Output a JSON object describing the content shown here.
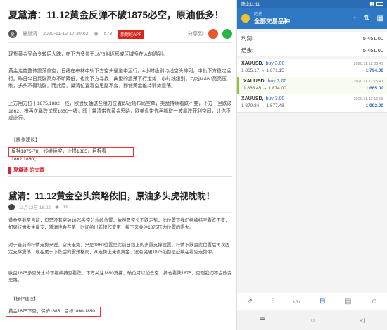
{
  "article1": {
    "title": "夏黛清：11.12黄金反弹不破1875必空，原油低多！",
    "author": "夏黛清",
    "datetime": "2020-11-12 17:30:02",
    "views": "573",
    "app_badge": "新财经APP",
    "share_label": "分享到:",
    "paragraphs": [
      "现货黄金受命令转后大跌，在下方多位于1875附近形成区域多在大的遇到。",
      "黄金走势整体震荡偏空，日线在布林中轨下方空头通道中运行。4小时级别均线空头排列，中轨下方稳定运行。昨日今日反弹高点不断降低，也比下方寻找，典型的震荡下行走势，小时线级别，均线MA60亮亮压制，多头不得动弹，而此后，黛清位置看空思路不变，即使黄金维持弱势震荡。",
      "上方阻力位于1875,1882一线，欧盘反抽这些阻力位置即近场布局空单，美盘持续看跌不变，下方一旦跌破1862，将再次暴跌试探1850一线，即上黛清带你黄金思路，欧美盘带你再抓取一波暴跌获利空间，让你不虚此行。"
    ],
    "advice_label": "【操作建议】",
    "advice": "反抽1875-78一线继续空，止损1885，目标看1862,1850；"
  },
  "more": {
    "label": "夏黛清 的文章"
  },
  "article2": {
    "title": "黛清：11.12黄金空头策略依旧，原油多头虎视眈眈！",
    "date": "11月12日 16:22",
    "views": "18",
    "paragraphs": [
      "黄金至截至目前，但是没有突破1875多空分水岭位置，依然是空头下跌走势，此位置下我们继续持空看跌不变，如果行情发生反支，黛清也会在第一时间给出新操作变更，接下来关注1875压力位置的得失。",
      "对于当前的行情走势来说，空头走势，只是1860位置是此前日线上的多重支撑位置，行情下跌至此位置后再次固定支撑震荡，现在属于下跌后的震荡格局，从走势上来说黄金，没有突破1875前都是延续在看空走势中。",
      "欧盘1875多空分水岭下继续持空看跌，下方关注1850支撑，破位可以加仓空，持仓看跌1875，否则我们不会改变思路。"
    ],
    "advice_label": "【操作建议】",
    "advice": "黄金1875下空，保护1885，目标1860-1850；"
  },
  "app": {
    "status_time": "晚上11:11",
    "subtitle": "历史",
    "title": "全部交易品种",
    "profit_label": "利润:",
    "profit_value": "5 451.00",
    "balance_label": "结余:",
    "balance_value": "5 451.00",
    "trades": [
      {
        "symbol": "XAUUSD,",
        "side": "buy 3.00",
        "time": "2020.11.12 03:49",
        "prices": "1 865.17 → 1 871.15",
        "pl": "1 794.00"
      },
      {
        "symbol": "XAUUSD,",
        "side": "buy 3.00",
        "time": "2020.11.12 15:41",
        "prices": "1 868.45 → 1 874.00",
        "pl": "1 665.00"
      },
      {
        "symbol": "XAUUSD,",
        "side": "buy 3.00",
        "time": "2020.11.12 16:08",
        "prices": "1 870.84 → 1 877.48",
        "pl": "1 992.00"
      }
    ],
    "tabs": [
      "⇗",
      "⫶",
      "〰",
      "⊟",
      "▤",
      "☺"
    ],
    "nav": [
      "☰",
      "○",
      "◁"
    ]
  },
  "colors": {
    "accent": "#2f78c4",
    "alert": "#e33333",
    "gain": "#2c66c9"
  }
}
